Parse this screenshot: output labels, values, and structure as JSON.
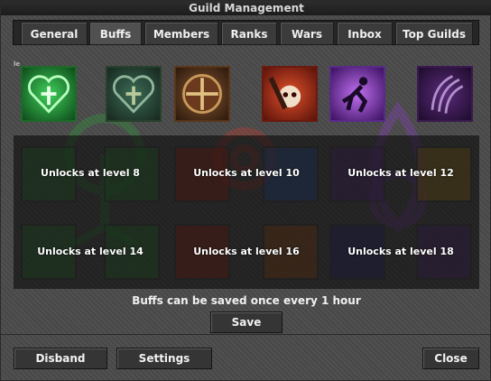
{
  "window": {
    "title": "Guild Management"
  },
  "tabs": [
    {
      "label": "General"
    },
    {
      "label": "Buffs",
      "active": true
    },
    {
      "label": "Members"
    },
    {
      "label": "Ranks"
    },
    {
      "label": "Wars"
    },
    {
      "label": "Inbox"
    },
    {
      "label": "Top Guilds"
    }
  ],
  "top_icons": [
    {
      "icon": "green-heart-cross-icon"
    },
    {
      "icon": "dark-heart-cross-icon"
    },
    {
      "icon": "shield-cross-icon"
    },
    {
      "icon": "skull-hammer-icon"
    },
    {
      "icon": "purple-runner-icon"
    },
    {
      "icon": "purple-claw-icon"
    }
  ],
  "locked_slots": [
    {
      "label": "Unlocks at level 8"
    },
    {
      "label": "Unlocks at level 10"
    },
    {
      "label": "Unlocks at level 12"
    },
    {
      "label": "Unlocks at level 14"
    },
    {
      "label": "Unlocks at level 16"
    },
    {
      "label": "Unlocks at level 18"
    }
  ],
  "buffs_note": "Buffs can be saved once every 1 hour",
  "buttons": {
    "save": "Save",
    "disband": "Disband",
    "settings": "Settings",
    "close": "Close"
  },
  "colors": {
    "green": "#2e9b3a",
    "red": "#c0392b",
    "purple": "#8a3fc0"
  }
}
